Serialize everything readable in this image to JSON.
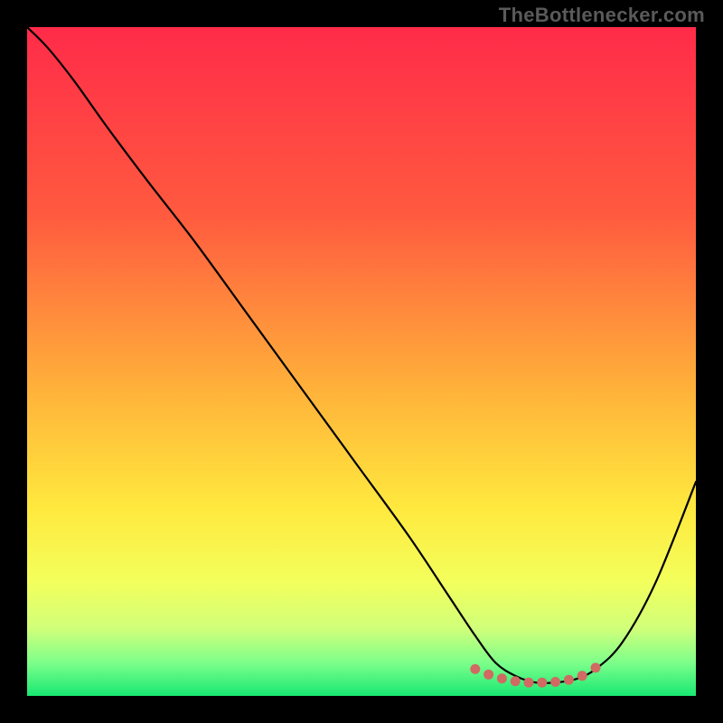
{
  "watermark": "TheBottlenecker.com",
  "chart_data": {
    "type": "line",
    "title": "",
    "xlabel": "",
    "ylabel": "",
    "xlim": [
      0,
      100
    ],
    "ylim": [
      0,
      100
    ],
    "gradient_stops": [
      {
        "offset": 0,
        "color": "#ff2b49"
      },
      {
        "offset": 28,
        "color": "#ff5a3f"
      },
      {
        "offset": 55,
        "color": "#ffb43a"
      },
      {
        "offset": 72,
        "color": "#ffe93e"
      },
      {
        "offset": 83,
        "color": "#f3ff5c"
      },
      {
        "offset": 90,
        "color": "#d0ff7a"
      },
      {
        "offset": 95,
        "color": "#7dff8a"
      },
      {
        "offset": 100,
        "color": "#18e873"
      }
    ],
    "series": [
      {
        "name": "bottleneck-curve",
        "color": "#000000",
        "stroke_width": 2.2,
        "x": [
          0,
          3,
          7,
          12,
          18,
          25,
          33,
          41,
          49,
          57,
          63,
          67,
          70,
          73,
          76,
          79,
          82,
          85,
          89,
          94,
          100
        ],
        "y": [
          100,
          97,
          92,
          85,
          77,
          68,
          57,
          46,
          35,
          24,
          15,
          9,
          5,
          3,
          2,
          2,
          2.5,
          4,
          8,
          17,
          32
        ]
      }
    ],
    "dots": {
      "name": "optimal-range",
      "color": "#d06a63",
      "radius": 5.5,
      "x": [
        67,
        69,
        71,
        73,
        75,
        77,
        79,
        81,
        83,
        85
      ],
      "y": [
        4.0,
        3.2,
        2.6,
        2.2,
        2.0,
        2.0,
        2.1,
        2.4,
        3.0,
        4.2
      ]
    }
  }
}
